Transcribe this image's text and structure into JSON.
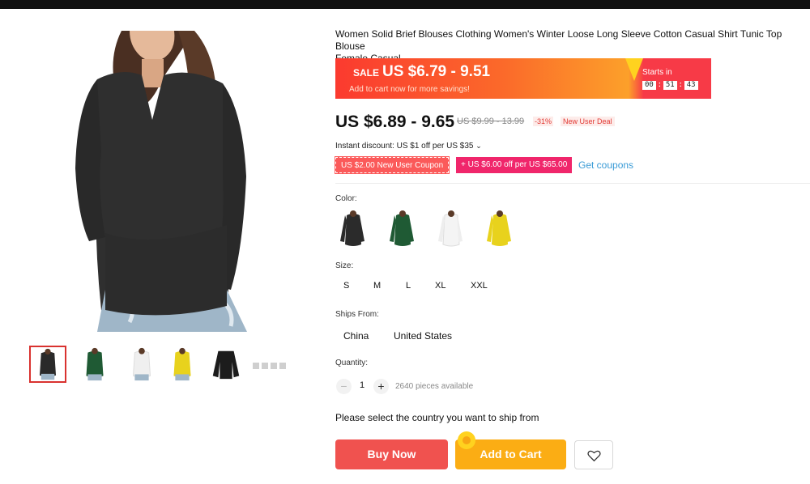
{
  "product": {
    "title": "Women Solid Brief Blouses Clothing Women's Winter Loose Long Sleeve Cotton Casual Shirt Tunic Top Blouse\nFemale Casual"
  },
  "gallery": {
    "main_image": "woman-dark-vneck-longsleeve-photo",
    "thumbnails": [
      {
        "name": "thumb-black",
        "color": "#2a2a2a"
      },
      {
        "name": "thumb-green",
        "color": "#1f5a34"
      },
      {
        "name": "thumb-white",
        "color": "#f2f2f2"
      },
      {
        "name": "thumb-yellow",
        "color": "#e8d21d"
      },
      {
        "name": "thumb-black-flat",
        "color": "#1c1c1c"
      }
    ]
  },
  "sale_banner": {
    "flag": "SALE",
    "price": "US $6.79 - 9.51",
    "subtitle": "Add to cart now for more savings!",
    "starts_label": "Starts in",
    "timer": {
      "hours": "00",
      "minutes": "51",
      "seconds": "43"
    }
  },
  "pricing": {
    "current": "US $6.89 - 9.65",
    "original": "US $9.99 - 13.99",
    "discount": "-31%",
    "deal_badge": "New User Deal"
  },
  "promotions": {
    "instant_discount": "Instant discount: US $1 off per US $35",
    "coupon_1": "US $2.00 New User Coupon",
    "coupon_2": "+ US $6.00 off per US $65.00",
    "get_coupons": "Get coupons"
  },
  "options": {
    "color_label": "Color:",
    "colors": [
      {
        "name": "black",
        "hex": "#2b2b2b"
      },
      {
        "name": "green",
        "hex": "#1f5a34"
      },
      {
        "name": "white",
        "hex": "#f4f4f4"
      },
      {
        "name": "yellow",
        "hex": "#e8d21d"
      }
    ],
    "size_label": "Size:",
    "sizes": [
      "S",
      "M",
      "L",
      "XL",
      "XXL"
    ],
    "ships_from_label": "Ships From:",
    "ships_from": [
      "China",
      "United States"
    ],
    "quantity_label": "Quantity:",
    "quantity": "1",
    "minus": "−",
    "plus": "+",
    "available": "2640 pieces available"
  },
  "shipping_note": "Please select the country you want to ship from",
  "actions": {
    "buy_now": "Buy Now",
    "add_to_cart": "Add to Cart",
    "wishlist_icon": "heart-icon"
  },
  "colors": {
    "sale_red": "#fb3a2f",
    "price_red": "#e23a35",
    "buy_now": "#f0524f",
    "add_to_cart": "#fbad14",
    "link_blue": "#3a9bd6"
  }
}
